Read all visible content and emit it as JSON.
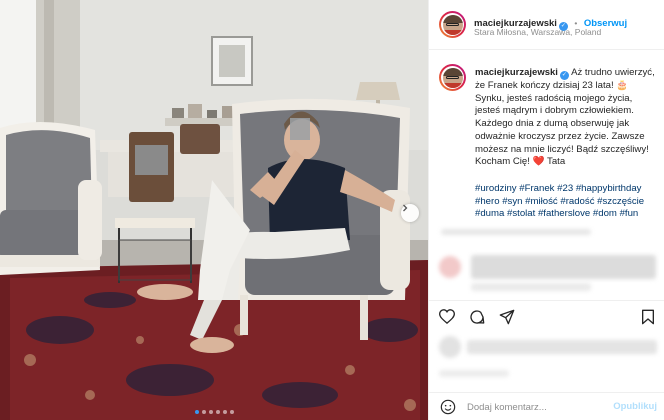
{
  "post": {
    "username": "maciejkurzajewski",
    "follow_label": "Obserwuj",
    "separator": "•",
    "location": "Stara Miłosna, Warszawa, Poland",
    "more_label": "...",
    "caption": "Aż trudno uwierzyć, że Franek kończy dzisiaj 23 lata! 🎂 Synku, jesteś radością mojego życia, jesteś mądrym i dobrym człowiekiem. Każdego dnia z dumą obserwuję jak odważnie kroczysz przez życie. Zawsze możesz na mnie liczyć! Bądź szczęśliwy! Kocham Cię! ❤️ Tata",
    "hashtags": [
      "#urodziny",
      "#Franek",
      "#23",
      "#happybirthday",
      "#hero",
      "#syn",
      "#miłość",
      "#radość",
      "#szczęście",
      "#duma",
      "#stolat",
      "#fatherslove",
      "#dom",
      "#fun"
    ]
  },
  "comment": {
    "placeholder": "Dodaj komentarz...",
    "post_label": "Opublikuj"
  },
  "carousel": {
    "slide_count": 6,
    "active_slide": 1
  },
  "icons": {
    "verified": "verified-badge-icon",
    "like": "heart-icon",
    "comment": "comment-bubble-icon",
    "share": "paper-plane-icon",
    "save": "bookmark-icon",
    "emoji": "emoji-smiley-icon",
    "next": "chevron-right-icon"
  },
  "colors": {
    "accent": "#0095f6",
    "link": "#00376b",
    "muted": "#8e8e8e"
  }
}
